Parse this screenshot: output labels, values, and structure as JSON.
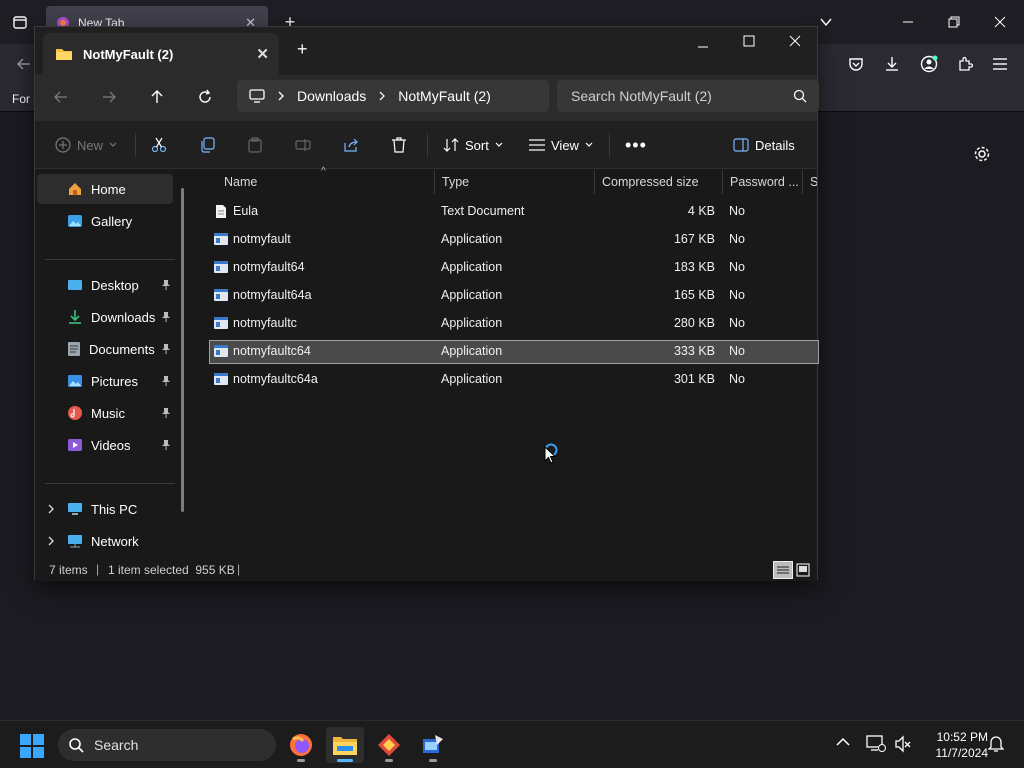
{
  "browser": {
    "tab_title": "New Tab",
    "bookmarks_text": "For q"
  },
  "window": {
    "tab_title": "NotMyFault (2)"
  },
  "address": {
    "crumbs": [
      "Downloads",
      "NotMyFault (2)"
    ],
    "search_placeholder": "Search NotMyFault (2)"
  },
  "commands": {
    "new_label": "New",
    "sort_label": "Sort",
    "view_label": "View",
    "details_label": "Details"
  },
  "sidebar": {
    "items": [
      {
        "label": "Home",
        "icon": "home-icon"
      },
      {
        "label": "Gallery",
        "icon": "gallery-icon"
      },
      {
        "label": "Desktop",
        "icon": "desktop-icon"
      },
      {
        "label": "Downloads",
        "icon": "download-icon"
      },
      {
        "label": "Documents",
        "icon": "documents-icon"
      },
      {
        "label": "Pictures",
        "icon": "pictures-icon"
      },
      {
        "label": "Music",
        "icon": "music-icon"
      },
      {
        "label": "Videos",
        "icon": "videos-icon"
      },
      {
        "label": "This PC",
        "icon": "pc-icon"
      },
      {
        "label": "Network",
        "icon": "network-icon"
      }
    ]
  },
  "columns": [
    "Name",
    "Type",
    "Compressed size",
    "Password ...",
    "Si"
  ],
  "files": [
    {
      "name": "Eula",
      "type": "Text Document",
      "size": "4 KB",
      "password": "No"
    },
    {
      "name": "notmyfault",
      "type": "Application",
      "size": "167 KB",
      "password": "No"
    },
    {
      "name": "notmyfault64",
      "type": "Application",
      "size": "183 KB",
      "password": "No"
    },
    {
      "name": "notmyfault64a",
      "type": "Application",
      "size": "165 KB",
      "password": "No"
    },
    {
      "name": "notmyfaultc",
      "type": "Application",
      "size": "280 KB",
      "password": "No"
    },
    {
      "name": "notmyfaultc64",
      "type": "Application",
      "size": "333 KB",
      "password": "No"
    },
    {
      "name": "notmyfaultc64a",
      "type": "Application",
      "size": "301 KB",
      "password": "No"
    }
  ],
  "status": {
    "count": "7 items",
    "selection": "1 item selected  955 KB"
  },
  "taskbar": {
    "search_label": "Search",
    "time": "10:52 PM",
    "date": "11/7/2024"
  }
}
